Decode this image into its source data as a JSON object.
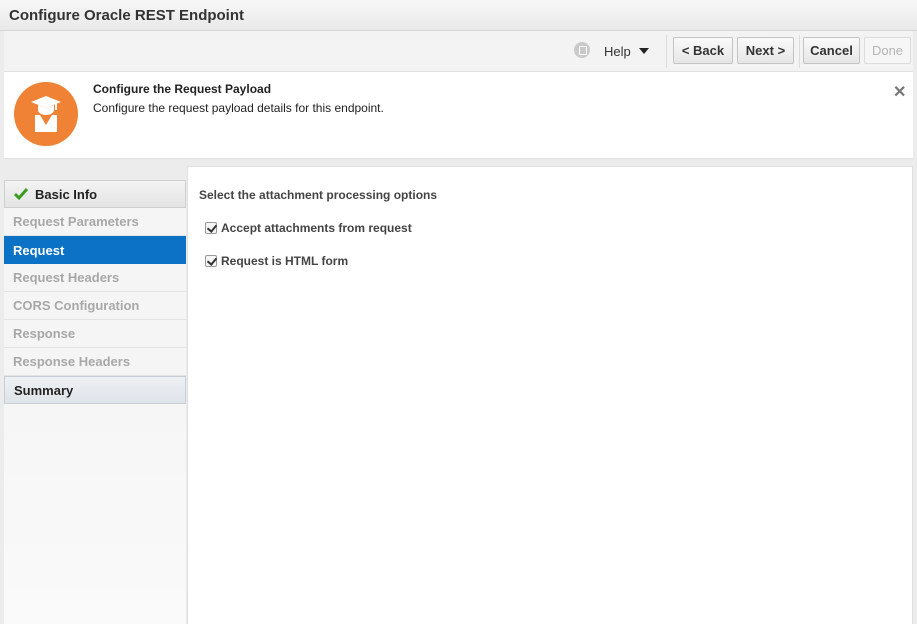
{
  "window": {
    "title": "Configure Oracle REST Endpoint"
  },
  "toolbar": {
    "help_label": "Help",
    "back_label": "< Back",
    "next_label": "Next >",
    "cancel_label": "Cancel",
    "done_label": "Done"
  },
  "header": {
    "title": "Configure the Request Payload",
    "description": "Configure the request payload details for this endpoint.",
    "accent": "#ef8234"
  },
  "sidebar": {
    "items": [
      {
        "label": "Basic Info",
        "state": "completed"
      },
      {
        "label": "Request Parameters",
        "state": "disabled"
      },
      {
        "label": "Request",
        "state": "active"
      },
      {
        "label": "Request Headers",
        "state": "disabled"
      },
      {
        "label": "CORS Configuration",
        "state": "disabled"
      },
      {
        "label": "Response",
        "state": "disabled"
      },
      {
        "label": "Response Headers",
        "state": "disabled"
      },
      {
        "label": "Summary",
        "state": "enabled"
      }
    ]
  },
  "main": {
    "section_label": "Select the attachment processing options",
    "options": [
      {
        "label": "Accept attachments from request",
        "checked": true
      },
      {
        "label": "Request is HTML form",
        "checked": true
      }
    ]
  },
  "colors": {
    "active_nav": "#0b72c6",
    "check_green": "#3a9b1f"
  }
}
